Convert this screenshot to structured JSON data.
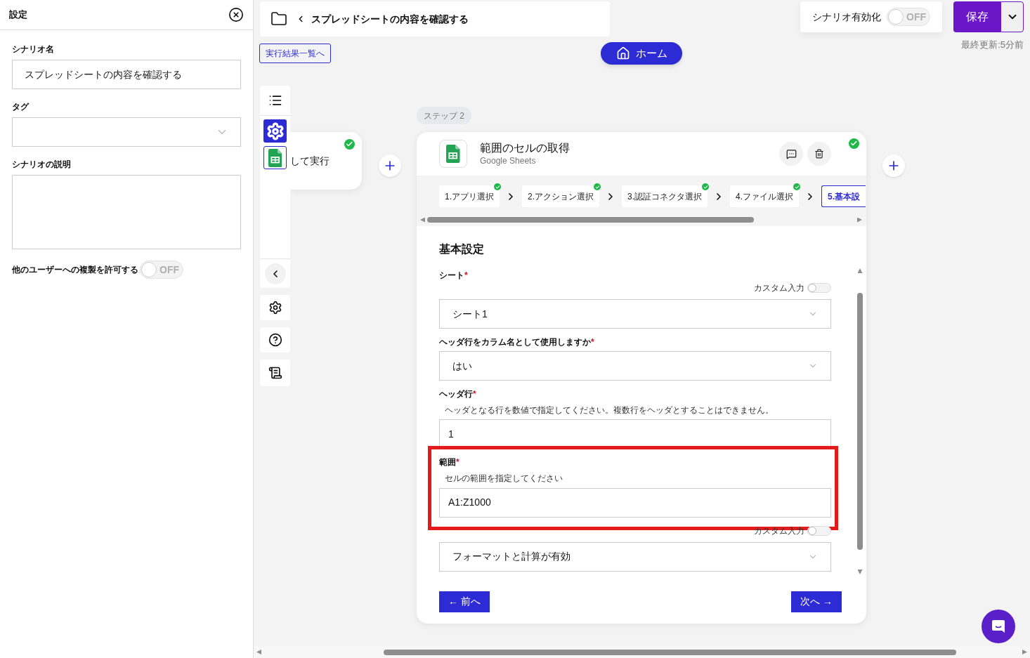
{
  "settings_panel": {
    "title": "設定",
    "fields": [
      {
        "label": "シナリオ名",
        "kind": "text",
        "value": "スプレッドシートの内容を確認する"
      },
      {
        "label": "タグ",
        "kind": "select"
      },
      {
        "label": "シナリオの説明",
        "kind": "textarea"
      }
    ],
    "allow_copy": {
      "label": "他のユーザーへの複製を許可する",
      "on": false,
      "state_text": "OFF"
    }
  },
  "header": {
    "title": "スプレッドシートの内容を確認する",
    "results_link": "実行結果一覧へ",
    "home_button": "ホーム"
  },
  "scenario_toggle": {
    "label": "シナリオ有効化",
    "on": false,
    "state_text": "OFF"
  },
  "save_button": "保存",
  "last_updated": "最終更新:5分前",
  "prev_node": {
    "text": "して実行",
    "done": true
  },
  "step_badge": "ステップ 2",
  "step_card": {
    "title": "範囲のセルの取得",
    "app": "Google Sheets",
    "done": true,
    "wizard_steps": [
      {
        "label": "1.アプリ選択",
        "done": true,
        "selected": false
      },
      {
        "label": "2.アクション選択",
        "done": true,
        "selected": false
      },
      {
        "label": "3.認証コネクタ選択",
        "done": true,
        "selected": false
      },
      {
        "label": "4.ファイル選択",
        "done": true,
        "selected": false
      },
      {
        "label": "5.基本設",
        "done": false,
        "selected": true
      }
    ],
    "section_title": "基本設定",
    "fields": [
      {
        "label": "シート",
        "required_mark": "*",
        "kind": "select",
        "value": "シート1",
        "custom_input": {
          "label": "カスタム入力",
          "on": false
        }
      },
      {
        "label": "ヘッダ行をカラム名として使用しますか",
        "required_mark": "*",
        "kind": "select",
        "value": "はい"
      },
      {
        "label": "ヘッダ行",
        "required_mark": "*",
        "hint": "ヘッダとなる行を数値で指定してください。複数行をヘッダとすることはできません。",
        "kind": "text",
        "value": "1"
      },
      {
        "label": "範囲",
        "required_mark": "*",
        "hint": "セルの範囲を指定してください",
        "kind": "text",
        "value": "A1:Z1000",
        "highlighted": true
      },
      {
        "kind": "select",
        "value": "フォーマットと計算が有効",
        "custom_input": {
          "label": "カスタム入力",
          "on": false
        }
      }
    ],
    "prev_button": "← 前へ",
    "next_button": "次へ →"
  }
}
